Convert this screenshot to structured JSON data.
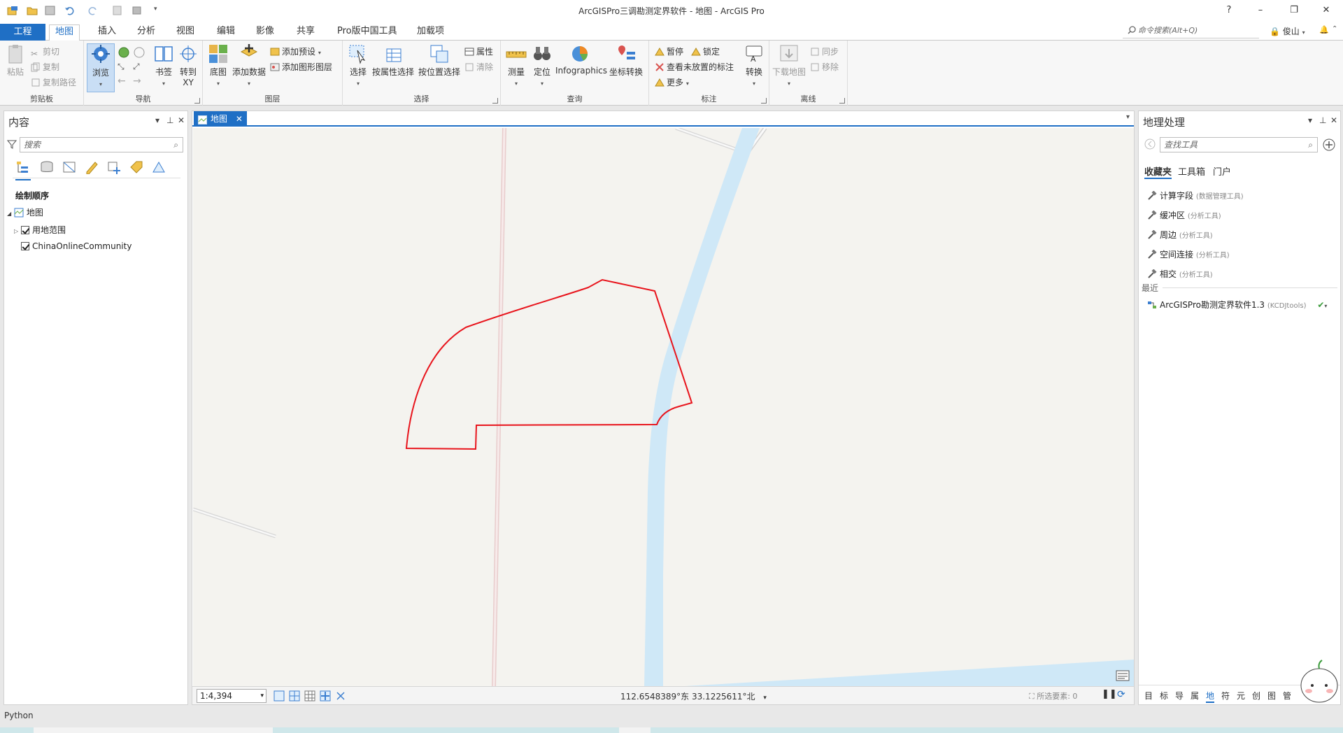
{
  "window": {
    "title": "ArcGISPro三调勘测定界软件 - 地图 - ArcGIS Pro",
    "help": "?",
    "minimize": "–",
    "restore": "❐",
    "close": "✕"
  },
  "ribbon_tabs": [
    "工程",
    "地图",
    "插入",
    "分析",
    "视图",
    "编辑",
    "影像",
    "共享",
    "Pro版中国工具",
    "加载项"
  ],
  "active_tab": "地图",
  "command_search": {
    "placeholder": "命令搜索(Alt+Q)"
  },
  "user": {
    "name": "俊山"
  },
  "ribbon": {
    "clipboard": {
      "label": "剪贴板",
      "paste": "粘贴",
      "cut": "剪切",
      "copy": "复制",
      "copy_path": "复制路径"
    },
    "navigate": {
      "label": "导航",
      "explore": "浏览",
      "bookmarks": "书签",
      "goto_xy_1": "转到",
      "goto_xy_2": "XY"
    },
    "layer": {
      "label": "图层",
      "basemap": "底图",
      "add_data": "添加数据",
      "add_preset": "添加预设",
      "add_graphics_layer": "添加图形图层"
    },
    "selection": {
      "label": "选择",
      "select": "选择",
      "select_by_attributes": "按属性选择",
      "select_by_location": "按位置选择",
      "attributes": "属性",
      "clear": "清除"
    },
    "inquiry": {
      "label": "查询",
      "measure": "测量",
      "locate": "定位",
      "infographics": "Infographics",
      "convert_coordinates": "坐标转换"
    },
    "labeling": {
      "label": "标注",
      "pause": "暂停",
      "lock": "锁定",
      "view_unplaced": "查看未放置的标注",
      "more": "更多",
      "convert": "转换"
    },
    "offline": {
      "label": "离线",
      "download_map": "下载地图",
      "sync": "同步",
      "remove": "移除"
    }
  },
  "contents_pane": {
    "title": "内容",
    "search_placeholder": "搜索",
    "drawing_order": "绘制顺序",
    "map_name": "地图",
    "layers": [
      {
        "name": "用地范围",
        "checked": true
      },
      {
        "name": "ChinaOnlineCommunity",
        "checked": true
      }
    ]
  },
  "map_view": {
    "tab_title": "地图",
    "scale": "1:4,394",
    "coordinates": "112.6548389°东 33.1225611°北",
    "selected_features": "所选要素: 0",
    "parcel_color": "#e8141c",
    "water_color": "#cfe8f7",
    "background_color": "#f4f3ef"
  },
  "geoprocessing": {
    "title": "地理处理",
    "search_placeholder": "查找工具",
    "tabs": [
      "收藏夹",
      "工具箱",
      "门户"
    ],
    "favorites": [
      {
        "name": "计算字段",
        "toolbox": "(数据管理工具)"
      },
      {
        "name": "缓冲区",
        "toolbox": "(分析工具)"
      },
      {
        "name": "周边",
        "toolbox": "(分析工具)"
      },
      {
        "name": "空间连接",
        "toolbox": "(分析工具)"
      },
      {
        "name": "相交",
        "toolbox": "(分析工具)"
      }
    ],
    "recent_label": "最近",
    "recent": [
      {
        "name": "ArcGISPro勘测定界软件1.3",
        "toolbox": "(KCDJtools)"
      }
    ],
    "bottom_tabs": [
      "目",
      "标",
      "导",
      "属",
      "地",
      "符",
      "元",
      "创",
      "图",
      "管"
    ]
  },
  "python_label": "Python"
}
